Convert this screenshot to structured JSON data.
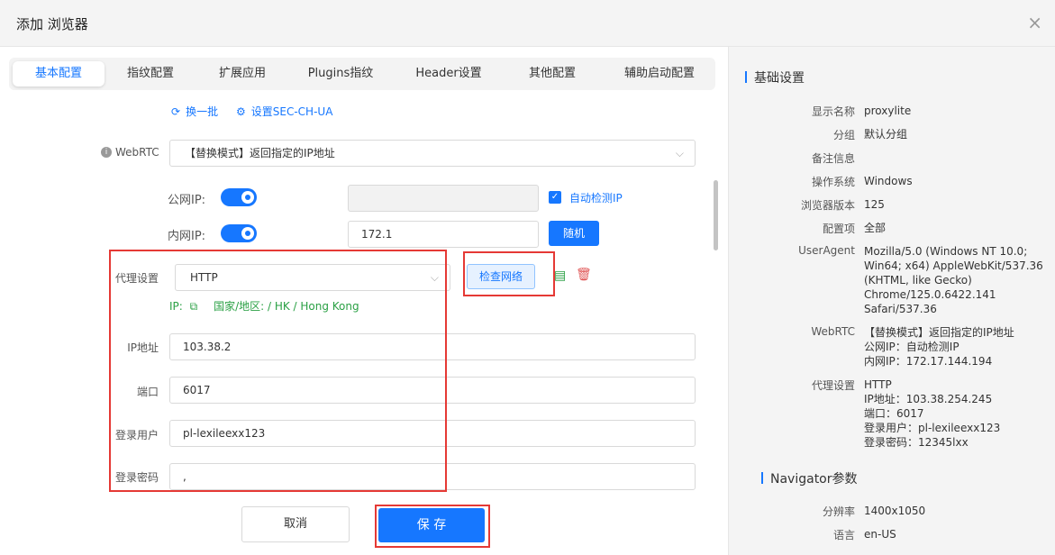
{
  "window": {
    "title": "添加 浏览器",
    "close_icon": "×"
  },
  "tabs": [
    "基本配置",
    "指纹配置",
    "扩展应用",
    "Plugins指纹",
    "Header设置",
    "其他配置",
    "辅助启动配置"
  ],
  "links": {
    "refresh": "换一批",
    "sec_ch_ua": "设置SEC-CH-UA"
  },
  "webrtc": {
    "label": "WebRTC",
    "value": "【替换模式】返回指定的IP地址"
  },
  "public_ip": {
    "label": "公网IP:",
    "auto_detect_label": "自动检测IP"
  },
  "private_ip": {
    "label": "内网IP:",
    "value": "172.1",
    "random_button": "随机"
  },
  "proxy": {
    "label": "代理设置",
    "type": "HTTP",
    "check_button": "检查网络",
    "ip_prefix": "IP:",
    "location": "国家/地区: / HK / Hong Kong",
    "ip_label": "IP地址",
    "ip_value": "103.38.2",
    "port_label": "端口",
    "port_value": "6017",
    "user_label": "登录用户",
    "user_value": "pl-lexileexx123",
    "pass_label": "登录密码",
    "pass_value": ","
  },
  "buttons": {
    "cancel": "取消",
    "save": "保 存"
  },
  "summary": {
    "basic_title": "基础设置",
    "rows": [
      {
        "k": "显示名称",
        "v": "proxylite"
      },
      {
        "k": "分组",
        "v": "默认分组"
      },
      {
        "k": "备注信息",
        "v": ""
      },
      {
        "k": "操作系统",
        "v": "Windows"
      },
      {
        "k": "浏览器版本",
        "v": "125"
      },
      {
        "k": "配置项",
        "v": "全部"
      }
    ],
    "useragent": {
      "k": "UserAgent",
      "lines": [
        "Mozilla/5.0 (Windows NT 10.0;",
        "Win64; x64) AppleWebKit/537.36",
        "(KHTML, like Gecko)",
        "Chrome/125.0.6422.141",
        "Safari/537.36"
      ]
    },
    "webrtc": {
      "k": "WebRTC",
      "lines": [
        "【替换模式】返回指定的IP地址",
        "公网IP：自动检测IP",
        "内网IP：172.17.144.194"
      ]
    },
    "proxy": {
      "k": "代理设置",
      "lines": [
        "HTTP",
        "IP地址：103.38.254.245",
        "端口：6017",
        "登录用户：pl-lexileexx123",
        "登录密码：12345lxx"
      ]
    },
    "navigator_title": "Navigator参数",
    "nav_rows": [
      {
        "k": "分辨率",
        "v": "1400x1050"
      },
      {
        "k": "语言",
        "v": "en-US"
      }
    ]
  },
  "colors": {
    "accent": "#1677ff",
    "highlight": "#e53935",
    "success": "#2aa044"
  }
}
